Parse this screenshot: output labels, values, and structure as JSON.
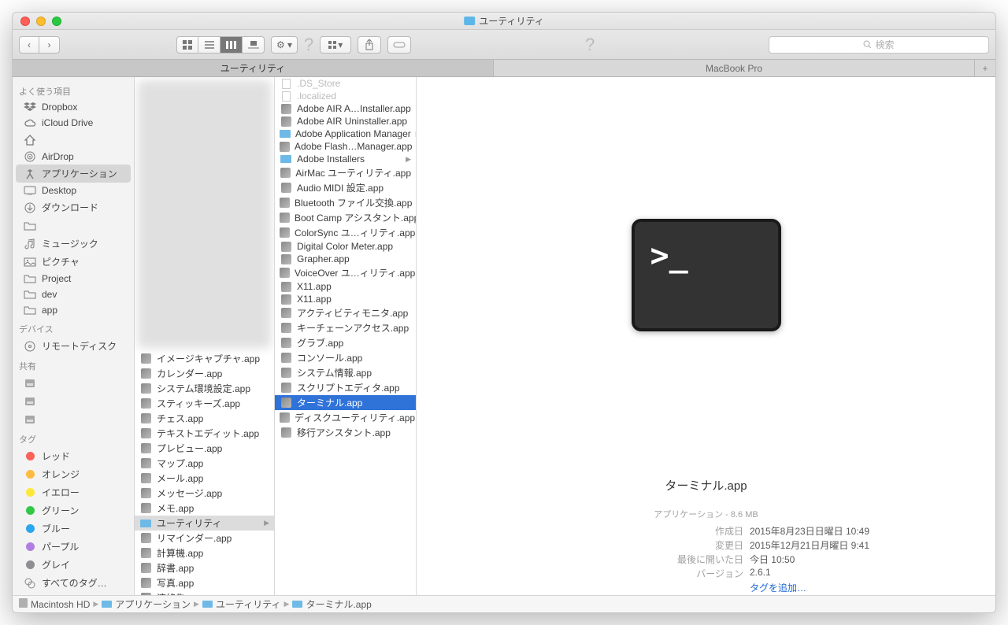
{
  "window_title": "ユーティリティ",
  "search_placeholder": "検索",
  "tabs": [
    "ユーティリティ",
    "MacBook Pro"
  ],
  "sidebar": {
    "sections": [
      {
        "header": "よく使う項目",
        "items": [
          {
            "icon": "dropbox",
            "label": "Dropbox"
          },
          {
            "icon": "cloud",
            "label": "iCloud Drive"
          },
          {
            "icon": "home",
            "label": "　　　　"
          },
          {
            "icon": "airdrop",
            "label": "AirDrop"
          },
          {
            "icon": "app",
            "label": "アプリケーション",
            "selected": true
          },
          {
            "icon": "desktop",
            "label": "Desktop"
          },
          {
            "icon": "download",
            "label": "ダウンロード"
          },
          {
            "icon": "folder",
            "label": "　　　"
          },
          {
            "icon": "music",
            "label": "ミュージック"
          },
          {
            "icon": "picture",
            "label": "ピクチャ"
          },
          {
            "icon": "folder",
            "label": "Project"
          },
          {
            "icon": "folder",
            "label": "dev"
          },
          {
            "icon": "folder",
            "label": "app"
          }
        ]
      },
      {
        "header": "デバイス",
        "items": [
          {
            "icon": "disc",
            "label": "リモートディスク"
          }
        ]
      },
      {
        "header": "共有",
        "items": [
          {
            "icon": "server",
            "label": "　　　　"
          },
          {
            "icon": "server",
            "label": "　　　　"
          },
          {
            "icon": "server",
            "label": "　　　　　"
          }
        ]
      },
      {
        "header": "タグ",
        "items": [
          {
            "tag": "#fc605b",
            "label": "レッド"
          },
          {
            "tag": "#fdbc40",
            "label": "オレンジ"
          },
          {
            "tag": "#fce83a",
            "label": "イエロー"
          },
          {
            "tag": "#33c748",
            "label": "グリーン"
          },
          {
            "tag": "#2aa7ee",
            "label": "ブルー"
          },
          {
            "tag": "#b07fe0",
            "label": "パープル"
          },
          {
            "tag": "#8e8e93",
            "label": "グレイ"
          },
          {
            "tag": "all",
            "label": "すべてのタグ…"
          }
        ]
      }
    ]
  },
  "col1": [
    {
      "label": "イメージキャプチャ.app"
    },
    {
      "label": "カレンダー.app"
    },
    {
      "label": "システム環境設定.app"
    },
    {
      "label": "スティッキーズ.app"
    },
    {
      "label": "チェス.app"
    },
    {
      "label": "テキストエディット.app"
    },
    {
      "label": "プレビュー.app"
    },
    {
      "label": "マップ.app"
    },
    {
      "label": "メール.app"
    },
    {
      "label": "メッセージ.app"
    },
    {
      "label": "メモ.app"
    },
    {
      "label": "ユーティリティ",
      "folder": true,
      "hi": true,
      "arrow": true
    },
    {
      "label": "リマインダー.app"
    },
    {
      "label": "計算機.app"
    },
    {
      "label": "辞書.app"
    },
    {
      "label": "写真.app"
    },
    {
      "label": "連絡先.app"
    }
  ],
  "col2": [
    {
      "label": ".DS_Store",
      "dim": true
    },
    {
      "label": ".localized",
      "dim": true
    },
    {
      "label": "Adobe AIR A…Installer.app"
    },
    {
      "label": "Adobe AIR Uninstaller.app"
    },
    {
      "label": "Adobe Application Manager",
      "folder": true,
      "arrow": true
    },
    {
      "label": "Adobe Flash…Manager.app"
    },
    {
      "label": "Adobe Installers",
      "folder": true,
      "arrow": true
    },
    {
      "label": "AirMac ユーティリティ.app"
    },
    {
      "label": "Audio MIDI 設定.app"
    },
    {
      "label": "Bluetooth ファイル交換.app"
    },
    {
      "label": "Boot Camp アシスタント.app"
    },
    {
      "label": "ColorSync ユ…ィリティ.app"
    },
    {
      "label": "Digital Color Meter.app"
    },
    {
      "label": "Grapher.app"
    },
    {
      "label": "VoiceOver ユ…ィリティ.app"
    },
    {
      "label": "X11.app"
    },
    {
      "label": "X11.app"
    },
    {
      "label": "アクティビティモニタ.app"
    },
    {
      "label": "キーチェーンアクセス.app"
    },
    {
      "label": "グラブ.app"
    },
    {
      "label": "コンソール.app"
    },
    {
      "label": "システム情報.app"
    },
    {
      "label": "スクリプトエディタ.app"
    },
    {
      "label": "ターミナル.app",
      "sel": true
    },
    {
      "label": "ディスクユーティリティ.app"
    },
    {
      "label": "移行アシスタント.app"
    }
  ],
  "preview": {
    "name": "ターミナル.app",
    "kind": "アプリケーション - 8.6 MB",
    "rows": [
      {
        "k": "作成日",
        "v": "2015年8月23日日曜日 10:49"
      },
      {
        "k": "変更日",
        "v": "2015年12月21日月曜日 9:41"
      },
      {
        "k": "最後に開いた日",
        "v": "今日 10:50"
      },
      {
        "k": "バージョン",
        "v": "2.6.1"
      }
    ],
    "addtag": "タグを追加…"
  },
  "path": [
    "Macintosh HD",
    "アプリケーション",
    "ユーティリティ",
    "ターミナル.app"
  ]
}
